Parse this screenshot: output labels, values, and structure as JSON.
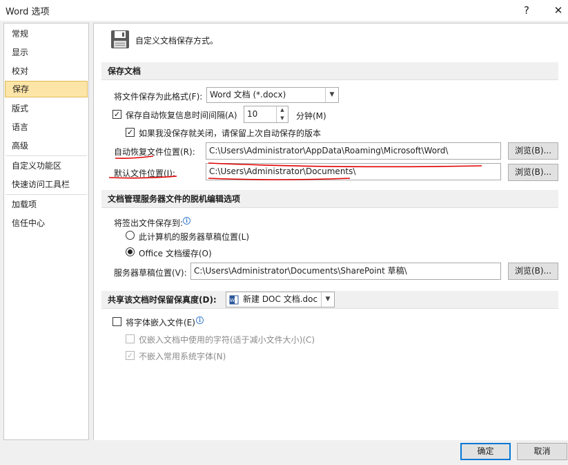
{
  "window": {
    "title": "Word 选项",
    "help": "?",
    "close": "✕"
  },
  "sidebar": {
    "items": [
      {
        "label": "常规"
      },
      {
        "label": "显示"
      },
      {
        "label": "校对"
      },
      {
        "label": "保存",
        "selected": true
      },
      {
        "label": "版式"
      },
      {
        "label": "语言"
      },
      {
        "label": "高级"
      },
      {
        "label": "自定义功能区"
      },
      {
        "label": "快速访问工具栏"
      },
      {
        "label": "加载项"
      },
      {
        "label": "信任中心"
      }
    ]
  },
  "header": {
    "text": "自定义文档保存方式。",
    "icon": "floppy-disk-icon"
  },
  "save_docs": {
    "section_title": "保存文档",
    "format_label": "将文件保存为此格式(F):",
    "format_value": "Word 文档 (*.docx)",
    "autorecover_label": "保存自动恢复信息时间间隔(A)",
    "autorecover_checked": true,
    "autorecover_minutes": "10",
    "minutes_unit": "分钟(M)",
    "keep_last_label": "如果我没保存就关闭，请保留上次自动保存的版本",
    "keep_last_checked": true,
    "autorecover_path_label": "自动恢复文件位置(R):",
    "autorecover_path": "C:\\Users\\Administrator\\AppData\\Roaming\\Microsoft\\Word\\",
    "default_path_label": "默认文件位置(I):",
    "default_path": "C:\\Users\\Administrator\\Documents\\",
    "browse_label": "浏览(B)..."
  },
  "offline": {
    "section_title": "文档管理服务器文件的脱机编辑选项",
    "checkout_label": "将签出文件保存到:",
    "option_server": "此计算机的服务器草稿位置(L)",
    "option_cache": "Office 文档缓存(O)",
    "selected": "cache",
    "drafts_label": "服务器草稿位置(V):",
    "drafts_path": "C:\\Users\\Administrator\\Documents\\SharePoint 草稿\\",
    "browse_label": "浏览(B)..."
  },
  "fidelity": {
    "section_title": "共享该文档时保留保真度(D):",
    "document": "新建 DOC 文档.doc",
    "embed_fonts_label": "将字体嵌入文件(E)",
    "embed_fonts_checked": false,
    "embed_used_only_label": "仅嵌入文档中使用的字符(适于减小文件大小)(C)",
    "embed_used_only_checked": false,
    "no_common_fonts_label": "不嵌入常用系统字体(N)",
    "no_common_fonts_checked": true
  },
  "footer": {
    "ok": "确定",
    "cancel": "取消"
  },
  "colors": {
    "annotation": "#e00000",
    "selected_bg": "#fde5a7",
    "primary_border": "#0078d7"
  }
}
